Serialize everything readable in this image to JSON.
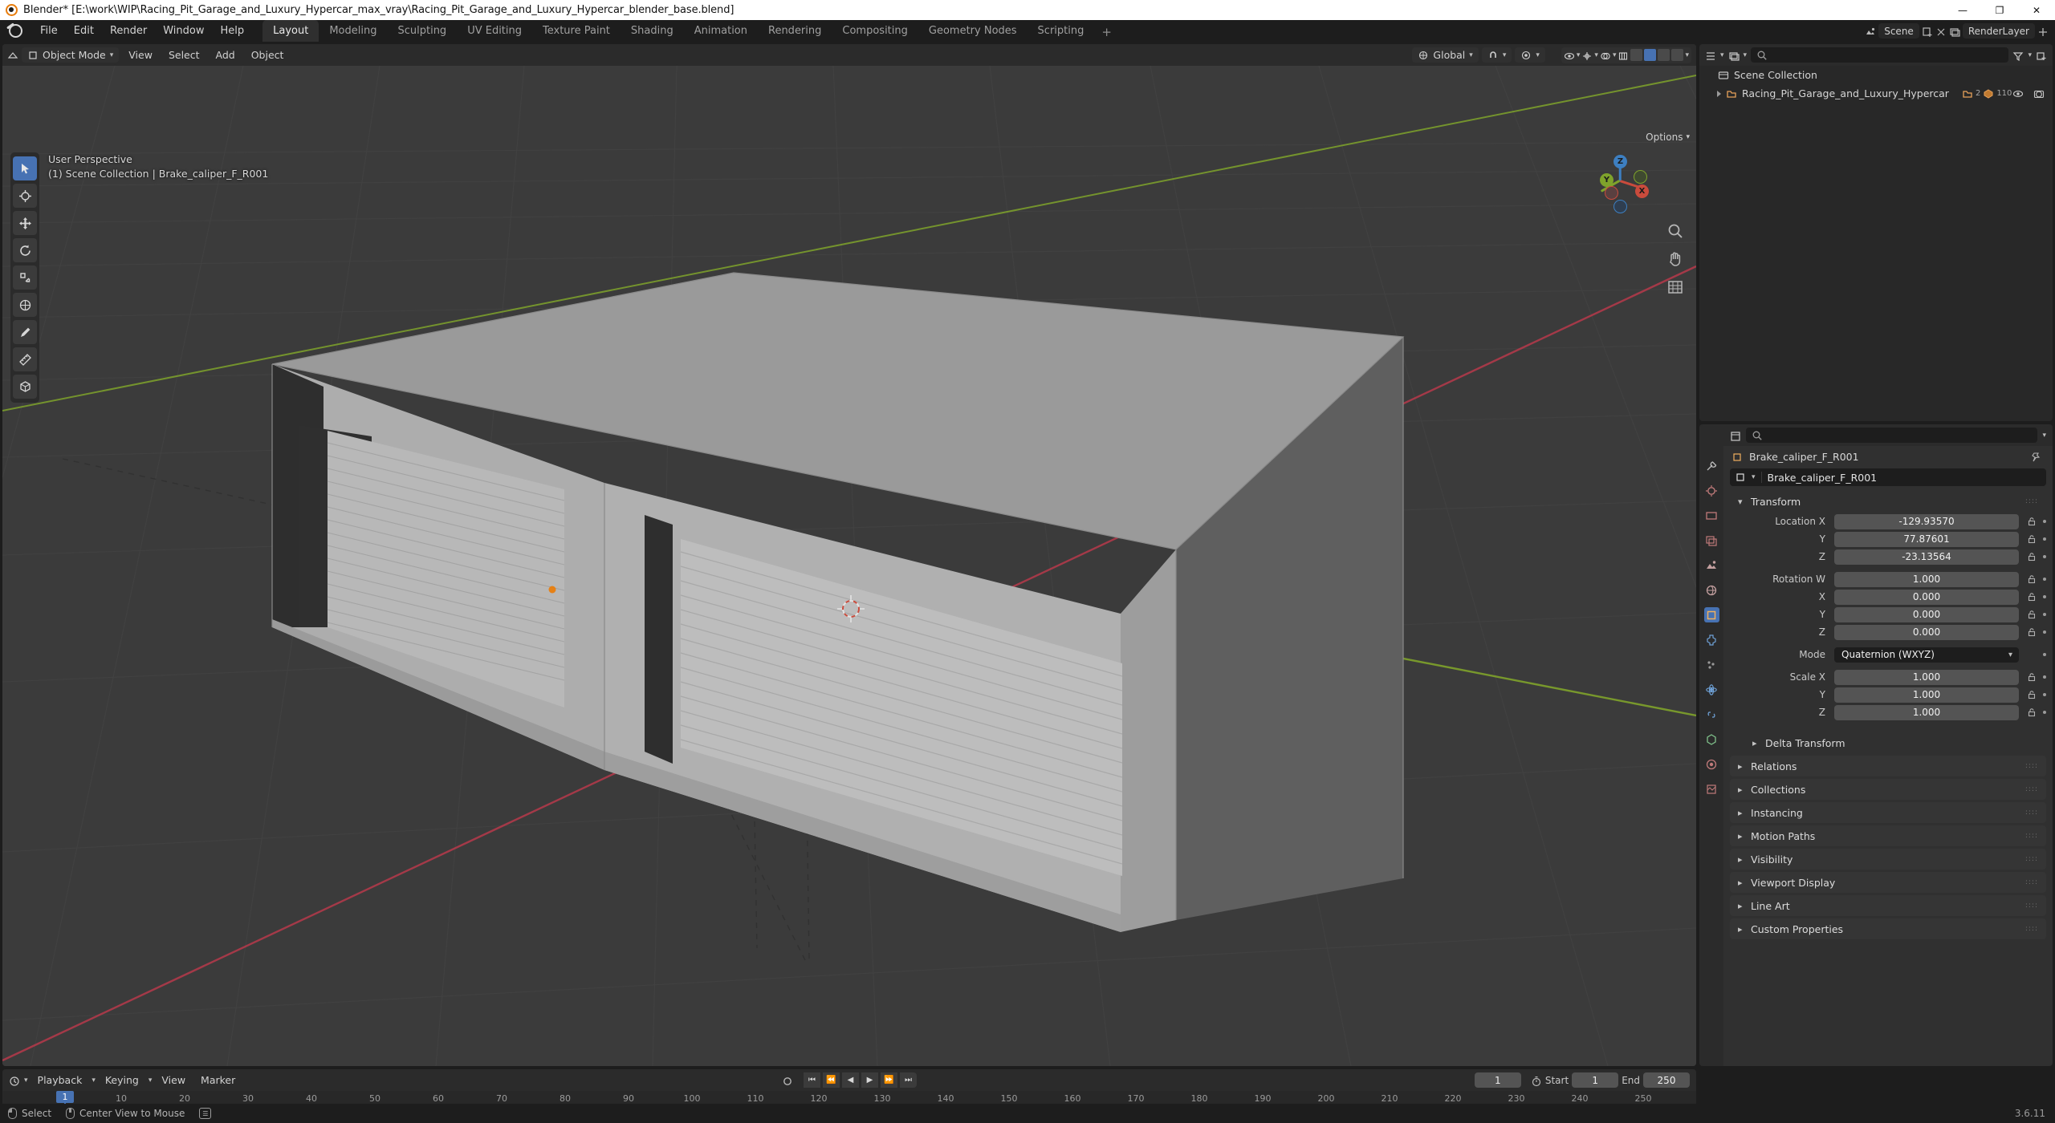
{
  "titlebar": {
    "app_title": "Blender* [E:\\work\\WIP\\Racing_Pit_Garage_and_Luxury_Hypercar_max_vray\\Racing_Pit_Garage_and_Luxury_Hypercar_blender_base.blend]",
    "minimize": "—",
    "maximize": "❐",
    "close": "✕"
  },
  "topbar": {
    "menus": [
      "File",
      "Edit",
      "Render",
      "Window",
      "Help"
    ],
    "workspace_tabs": [
      {
        "label": "Layout",
        "active": true
      },
      {
        "label": "Modeling",
        "active": false
      },
      {
        "label": "Sculpting",
        "active": false
      },
      {
        "label": "UV Editing",
        "active": false
      },
      {
        "label": "Texture Paint",
        "active": false
      },
      {
        "label": "Shading",
        "active": false
      },
      {
        "label": "Animation",
        "active": false
      },
      {
        "label": "Rendering",
        "active": false
      },
      {
        "label": "Compositing",
        "active": false
      },
      {
        "label": "Geometry Nodes",
        "active": false
      },
      {
        "label": "Scripting",
        "active": false
      }
    ],
    "add_workspace": "+",
    "scene_name": "Scene",
    "viewlayer_name": "RenderLayer"
  },
  "viewport": {
    "mode": "Object Mode",
    "menus": [
      "View",
      "Select",
      "Add",
      "Object"
    ],
    "orientation": "Global",
    "options_label": "Options",
    "overlay_line1": "User Perspective",
    "overlay_line2": "(1) Scene Collection | Brake_caliper_F_R001",
    "gizmo_axes": {
      "x_pos": "X",
      "x_neg": "",
      "y_pos": "Y",
      "y_neg": "",
      "z_pos": "Z",
      "z_neg": ""
    },
    "tools": [
      "tweak-tool",
      "cursor-tool",
      "move-tool",
      "rotate-tool",
      "scale-tool",
      "transform-tool",
      "annotate-tool",
      "measure-tool",
      "add-cube-tool"
    ]
  },
  "outliner": {
    "display_mode": "View Layer",
    "search_placeholder": "",
    "rows": [
      {
        "label": "Scene Collection",
        "indent": 0,
        "icon": "collection-icon"
      },
      {
        "label": "Racing_Pit_Garage_and_Luxury_Hypercar",
        "indent": 1,
        "icon": "collection-light-icon",
        "count_a": "2",
        "count_b": "110"
      }
    ]
  },
  "properties": {
    "breadcrumb_object": "Brake_caliper_F_R001",
    "object_name": "Brake_caliper_F_R001",
    "transform_panel": "Transform",
    "fields": [
      {
        "label": "Location X",
        "value": "-129.93570"
      },
      {
        "label": "Y",
        "value": "77.87601"
      },
      {
        "label": "Z",
        "value": "-23.13564"
      },
      {
        "label": "Rotation W",
        "value": "1.000"
      },
      {
        "label": "X",
        "value": "0.000"
      },
      {
        "label": "Y",
        "value": "0.000"
      },
      {
        "label": "Z",
        "value": "0.000"
      }
    ],
    "mode_label": "Mode",
    "mode_value": "Quaternion (WXYZ)",
    "scale_fields": [
      {
        "label": "Scale X",
        "value": "1.000"
      },
      {
        "label": "Y",
        "value": "1.000"
      },
      {
        "label": "Z",
        "value": "1.000"
      }
    ],
    "collapsed_panels": [
      "Delta Transform",
      "Relations",
      "Collections",
      "Instancing",
      "Motion Paths",
      "Visibility",
      "Viewport Display",
      "Line Art",
      "Custom Properties"
    ]
  },
  "timeline": {
    "menus": [
      "Playback",
      "Keying",
      "View",
      "Marker"
    ],
    "current_frame": "1",
    "start_label": "Start",
    "start_value": "1",
    "end_label": "End",
    "end_value": "250",
    "ticks": [
      "10",
      "20",
      "30",
      "40",
      "50",
      "60",
      "70",
      "80",
      "90",
      "100",
      "110",
      "120",
      "130",
      "140",
      "150",
      "160",
      "170",
      "180",
      "190",
      "200",
      "210",
      "220",
      "230",
      "240",
      "250"
    ],
    "playhead_frame": "1"
  },
  "statusbar": {
    "select_label": "Select",
    "center_view_label": "Center View to Mouse",
    "version": "3.6.11"
  },
  "colors": {
    "accent_blue": "#4772b3",
    "blender_orange": "#e87d0d",
    "axis_x": "#b03a4a",
    "axis_y": "#7fa32b",
    "axis_z": "#2f83c9",
    "panel_bg": "#303030",
    "header_bg": "#2b2b2b",
    "viewport_bg": "#3b3b3b"
  }
}
